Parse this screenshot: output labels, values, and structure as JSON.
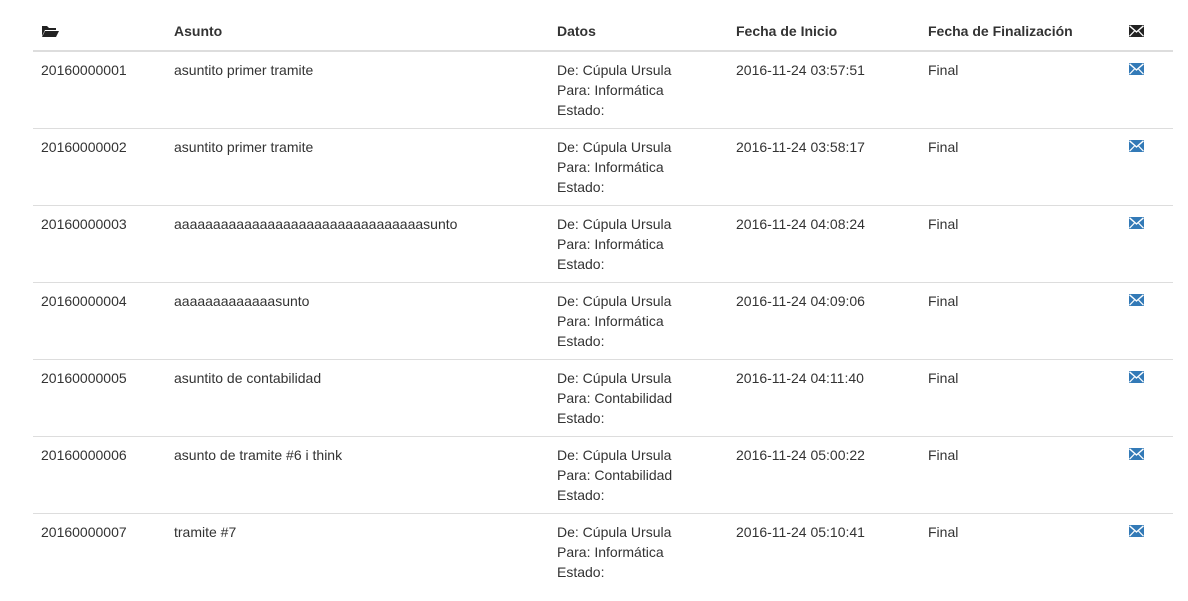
{
  "header": {
    "col_icon": "folder-open-icon",
    "col_asunto": "Asunto",
    "col_datos": "Datos",
    "col_inicio": "Fecha de Inicio",
    "col_fin": "Fecha de Finalización",
    "col_mail": "envelope-icon"
  },
  "colors": {
    "link": "#337ab7",
    "header_icon": "#222222",
    "border": "#dddddd"
  },
  "rows": [
    {
      "id": "20160000001",
      "asunto": "asuntito primer tramite",
      "de": "De: Cúpula Ursula",
      "para": "Para: Informática",
      "estado": "Estado:",
      "inicio": "2016-11-24 03:57:51",
      "fin": "Final"
    },
    {
      "id": "20160000002",
      "asunto": "asuntito primer tramite",
      "de": "De: Cúpula Ursula",
      "para": "Para: Informática",
      "estado": "Estado:",
      "inicio": "2016-11-24 03:58:17",
      "fin": "Final"
    },
    {
      "id": "20160000003",
      "asunto": "aaaaaaaaaaaaaaaaaaaaaaaaaaaaaaaasunto",
      "de": "De: Cúpula Ursula",
      "para": "Para: Informática",
      "estado": "Estado:",
      "inicio": "2016-11-24 04:08:24",
      "fin": "Final"
    },
    {
      "id": "20160000004",
      "asunto": "aaaaaaaaaaaaasunto",
      "de": "De: Cúpula Ursula",
      "para": "Para: Informática",
      "estado": "Estado:",
      "inicio": "2016-11-24 04:09:06",
      "fin": "Final"
    },
    {
      "id": "20160000005",
      "asunto": "asuntito de contabilidad",
      "de": "De: Cúpula Ursula",
      "para": "Para: Contabilidad",
      "estado": "Estado:",
      "inicio": "2016-11-24 04:11:40",
      "fin": "Final"
    },
    {
      "id": "20160000006",
      "asunto": "asunto de tramite #6 i think",
      "de": "De: Cúpula Ursula",
      "para": "Para: Contabilidad",
      "estado": "Estado:",
      "inicio": "2016-11-24 05:00:22",
      "fin": "Final"
    },
    {
      "id": "20160000007",
      "asunto": "tramite #7",
      "de": "De: Cúpula Ursula",
      "para": "Para: Informática",
      "estado": "Estado:",
      "inicio": "2016-11-24 05:10:41",
      "fin": "Final"
    }
  ]
}
